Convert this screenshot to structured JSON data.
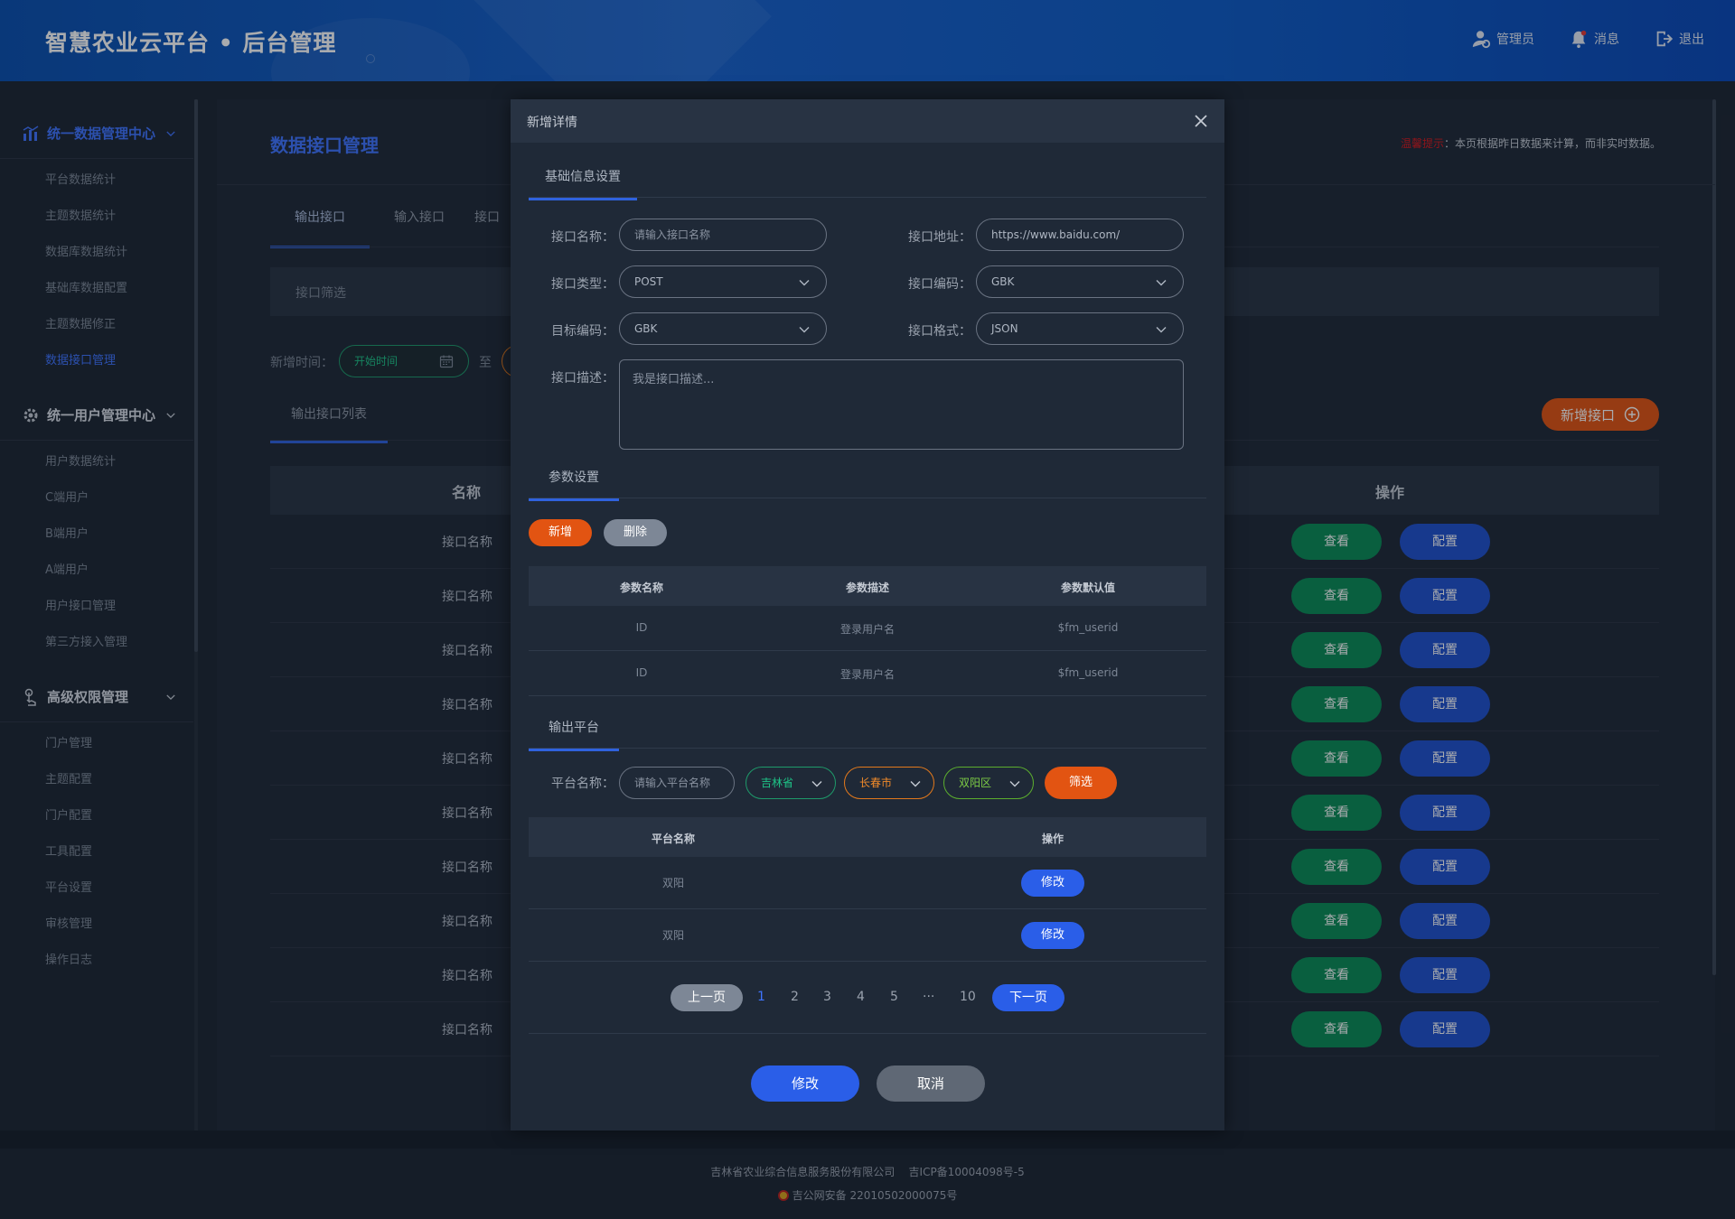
{
  "header": {
    "title": "智慧农业云平台 • 后台管理",
    "actions": [
      {
        "label": "管理员",
        "icon": "user-icon"
      },
      {
        "label": "消息",
        "icon": "bell-icon"
      },
      {
        "label": "退出",
        "icon": "logout-icon"
      }
    ]
  },
  "sidebar": {
    "groups": [
      {
        "title": "统一数据管理中心",
        "icon": "chart-icon",
        "items": [
          "平台数据统计",
          "主题数据统计",
          "数据库数据统计",
          "基础库数据配置",
          "主题数据修正",
          "数据接口管理"
        ]
      },
      {
        "title": "统一用户管理中心",
        "icon": "gear-icon",
        "items": [
          "用户数据统计",
          "C端用户",
          "B端用户",
          "A端用户",
          "用户接口管理",
          "第三方接入管理"
        ]
      },
      {
        "title": "高级权限管理",
        "icon": "touch-icon",
        "items": [
          "门户管理",
          "主题配置",
          "门户配置",
          "工具配置",
          "平台设置",
          "审核管理",
          "操作日志"
        ]
      }
    ]
  },
  "main": {
    "page_title": "数据接口管理",
    "tip_prefix": "温馨提示",
    "tip_text": "：本页根据昨日数据来计算，而非实时数据。",
    "tabs": [
      "输出接口",
      "输入接口",
      "接口"
    ],
    "filter_label": "接口筛选",
    "date_label": "新增时间：",
    "date_start_placeholder": "开始时间",
    "date_to": "至",
    "list_tab": "输出接口列表",
    "add_button": "新增接口",
    "col_name": "名称",
    "col_op": "操作",
    "rows": [
      "接口名称",
      "接口名称",
      "接口名称",
      "接口名称",
      "接口名称",
      "接口名称",
      "接口名称",
      "接口名称",
      "接口名称",
      "接口名称"
    ],
    "view_label": "查看",
    "config_label": "配置"
  },
  "footer": {
    "line1": "吉林省农业综合信息服务股份有限公司    吉ICP备10004098号-5",
    "line2": "吉公网安备 22010502000075号"
  },
  "modal": {
    "title": "新增详情",
    "basic_tab": "基础信息设置",
    "name_label": "接口名称：",
    "name_placeholder": "请输入接口名称",
    "url_label": "接口地址：",
    "url_value": "https://www.baidu.com/",
    "type_label": "接口类型：",
    "type_value": "POST",
    "encoding_label": "接口编码：",
    "encoding_value": "GBK",
    "target_label": "目标编码：",
    "target_value": "GBK",
    "format_label": "接口格式：",
    "format_value": "JSON",
    "desc_label": "接口描述：",
    "desc_placeholder": "我是接口描述...",
    "param_tab": "参数设置",
    "add_label": "新增",
    "delete_label": "删除",
    "param_cols": [
      "参数名称",
      "参数描述",
      "参数默认值"
    ],
    "param_rows": [
      [
        "ID",
        "登录用户名",
        "$fm_userid"
      ],
      [
        "ID",
        "登录用户名",
        "$fm_userid"
      ]
    ],
    "platform_tab": "输出平台",
    "platform_label": "平台名称：",
    "platform_placeholder": "请输入平台名称",
    "province": "吉林省",
    "city": "长春市",
    "district": "双阳区",
    "filter_btn": "筛选",
    "platform_cols": [
      "平台名称",
      "操作"
    ],
    "platform_rows": [
      "双阳",
      "双阳"
    ],
    "edit_label": "修改",
    "pager": {
      "prev": "上一页",
      "next": "下一页",
      "pages": [
        "1",
        "2",
        "3",
        "4",
        "5",
        "···",
        "10"
      ],
      "current": "1"
    },
    "submit_label": "修改",
    "cancel_label": "取消"
  },
  "colors": {
    "accent": "#3f74ff",
    "orange": "#e25412",
    "green": "#0a8a55",
    "blue_btn": "#2050cc",
    "gray_btn": "#7d8796"
  }
}
